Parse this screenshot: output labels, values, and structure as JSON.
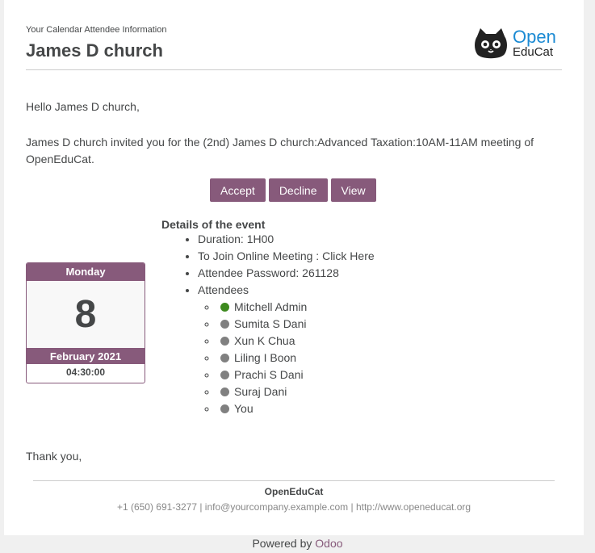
{
  "header": {
    "small_title": "Your Calendar Attendee Information",
    "title": "James D church",
    "logo_line1": "Open",
    "logo_line2": "EduCat"
  },
  "body": {
    "greeting": "Hello James D church,",
    "invite_text": "James D church invited you for the (2nd) James D church:Advanced Taxation:10AM-11AM meeting of OpenEduCat."
  },
  "buttons": {
    "accept": "Accept",
    "decline": "Decline",
    "view": "View"
  },
  "calendar": {
    "weekday": "Monday",
    "day": "8",
    "month_year": "February 2021",
    "time": "04:30:00"
  },
  "details": {
    "title": "Details of the event",
    "duration": "Duration: 1H00",
    "join": "To Join Online Meeting : Click Here",
    "password": "Attendee Password: 261128",
    "attendees_label": "Attendees",
    "attendees": [
      {
        "name": "Mitchell Admin",
        "color": "#3d8a1e"
      },
      {
        "name": "Sumita S Dani",
        "color": "#808080"
      },
      {
        "name": "Xun K Chua",
        "color": "#808080"
      },
      {
        "name": "Liling I Boon",
        "color": "#808080"
      },
      {
        "name": "Prachi S Dani",
        "color": "#808080"
      },
      {
        "name": "Suraj Dani",
        "color": "#808080"
      },
      {
        "name": "You",
        "color": "#808080"
      }
    ]
  },
  "closing": "Thank you,",
  "footer": {
    "company": "OpenEduCat",
    "info": "+1 (650) 691-3277 | info@yourcompany.example.com | http://www.openeducat.org",
    "powered_prefix": "Powered by ",
    "powered_link": "Odoo"
  },
  "colors": {
    "accent": "#875a7b",
    "accepted": "#3d8a1e",
    "pending": "#808080",
    "logo_blue": "#1b8ad3"
  }
}
